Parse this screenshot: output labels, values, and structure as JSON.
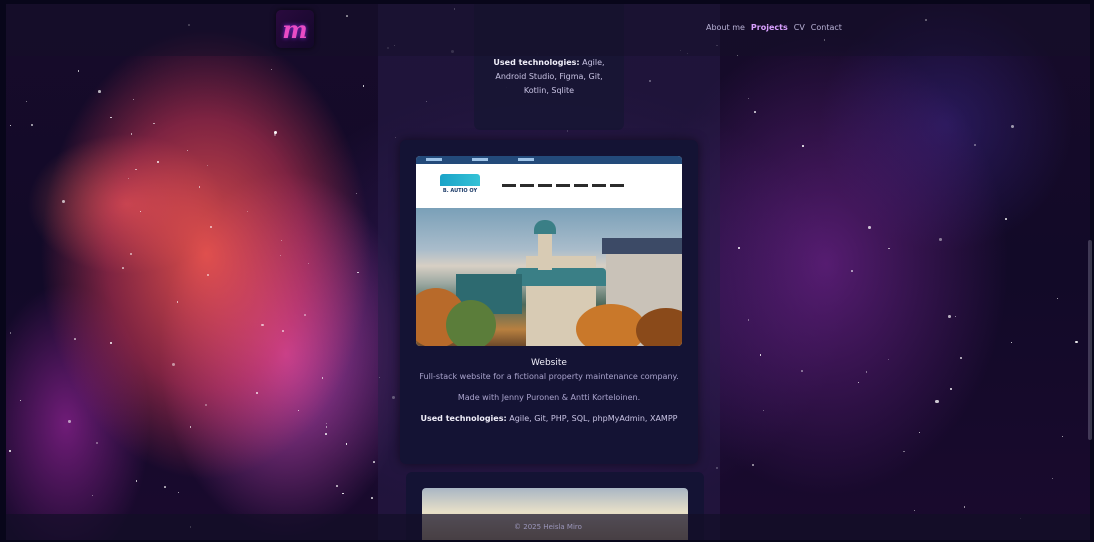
{
  "header": {
    "logo_letter": "m",
    "nav": [
      "About me",
      "Projects",
      "CV",
      "Contact"
    ],
    "active_nav": "Projects"
  },
  "project_above": {
    "tech_label": "Used technologies:",
    "tech_value": "Agile, Android Studio, Figma, Git, Kotlin, Sqlite"
  },
  "project": {
    "title": "Website",
    "description": "Full-stack website for a fictional property maintenance company.",
    "made_with": "Made with Jenny Puronen & Antti Korteloinen.",
    "tech_label": "Used technologies:",
    "tech_value": "Agile, Git, PHP, SQL, phpMyAdmin, XAMPP",
    "screenshot_logo_text": "B. AUTIO OY"
  },
  "footer": {
    "text": "© 2025 Heisla Miro"
  }
}
